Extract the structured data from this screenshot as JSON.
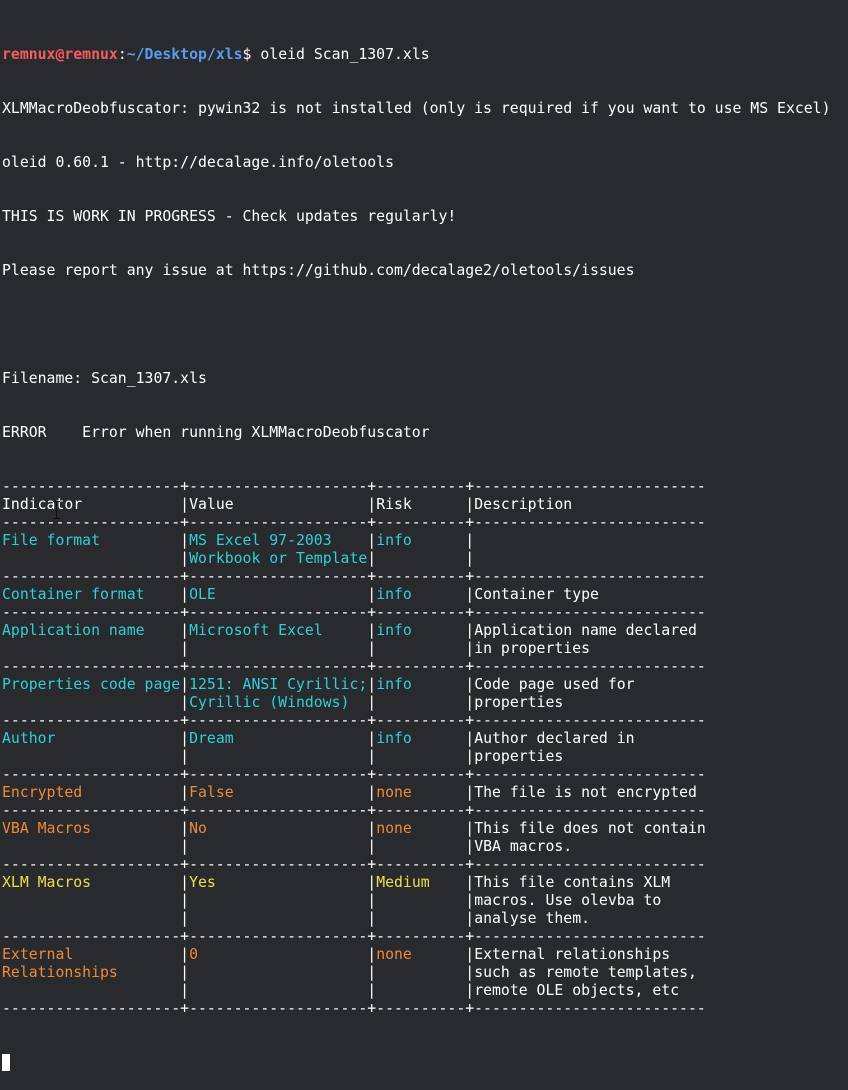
{
  "prompt": {
    "user_host": "remnux@remnux",
    "colon": ":",
    "path": "~/Desktop/xls",
    "dollar": "$ ",
    "command": "oleid Scan_1307.xls"
  },
  "header_lines": [
    "XLMMacroDeobfuscator: pywin32 is not installed (only is required if you want to use MS Excel)",
    "oleid 0.60.1 - http://decalage.info/oletools",
    "THIS IS WORK IN PROGRESS - Check updates regularly!",
    "Please report any issue at https://github.com/decalage2/oletools/issues",
    "",
    "Filename: Scan_1307.xls",
    "ERROR    Error when running XLMMacroDeobfuscator"
  ],
  "table": {
    "separator": "--------------------+--------------------+----------+--------------------------",
    "bar": "|",
    "headers": {
      "indicator": "Indicator",
      "value": "Value",
      "risk": "Risk",
      "description": "Description"
    },
    "rows": [
      {
        "color": "cyan",
        "lines": [
          {
            "indicator": "File format",
            "value": "MS Excel 97-2003",
            "risk": "info",
            "description": ""
          },
          {
            "indicator": "",
            "value": "Workbook or Template",
            "risk": "",
            "description": ""
          }
        ]
      },
      {
        "color": "cyan",
        "lines": [
          {
            "indicator": "Container format",
            "value": "OLE",
            "risk": "info",
            "description": "Container type"
          }
        ]
      },
      {
        "color": "cyan",
        "lines": [
          {
            "indicator": "Application name",
            "value": "Microsoft Excel",
            "risk": "info",
            "description": "Application name declared"
          },
          {
            "indicator": "",
            "value": "",
            "risk": "",
            "description": "in properties"
          }
        ]
      },
      {
        "color": "cyan",
        "lines": [
          {
            "indicator": "Properties code page",
            "value": "1251: ANSI Cyrillic;",
            "risk": "info",
            "description": "Code page used for"
          },
          {
            "indicator": "",
            "value": "Cyrillic (Windows)",
            "risk": "",
            "description": "properties"
          }
        ]
      },
      {
        "color": "cyan",
        "lines": [
          {
            "indicator": "Author",
            "value": "Dream",
            "risk": "info",
            "description": "Author declared in"
          },
          {
            "indicator": "",
            "value": "",
            "risk": "",
            "description": "properties"
          }
        ]
      },
      {
        "color": "orange",
        "lines": [
          {
            "indicator": "Encrypted",
            "value": "False",
            "risk": "none",
            "description": "The file is not encrypted"
          }
        ]
      },
      {
        "color": "orange",
        "lines": [
          {
            "indicator": "VBA Macros",
            "value": "No",
            "risk": "none",
            "description": "This file does not contain"
          },
          {
            "indicator": "",
            "value": "",
            "risk": "",
            "description": "VBA macros."
          }
        ]
      },
      {
        "color": "yellow",
        "lines": [
          {
            "indicator": "XLM Macros",
            "value": "Yes",
            "risk": "Medium",
            "description": "This file contains XLM"
          },
          {
            "indicator": "",
            "value": "",
            "risk": "",
            "description": "macros. Use olevba to"
          },
          {
            "indicator": "",
            "value": "",
            "risk": "",
            "description": "analyse them."
          }
        ]
      },
      {
        "color": "orange",
        "lines": [
          {
            "indicator": "External",
            "value": "0",
            "risk": "none",
            "description": "External relationships"
          },
          {
            "indicator": "Relationships",
            "value": "",
            "risk": "",
            "description": "such as remote templates,"
          },
          {
            "indicator": "",
            "value": "",
            "risk": "",
            "description": "remote OLE objects, etc"
          }
        ]
      }
    ]
  },
  "colors": {
    "background": "#282a2e",
    "cyan": "#2fd0d6",
    "orange": "#ef8a3a",
    "yellow": "#e8e14a",
    "prompt_user": "#f55d5d",
    "prompt_path": "#5a9bf0"
  }
}
